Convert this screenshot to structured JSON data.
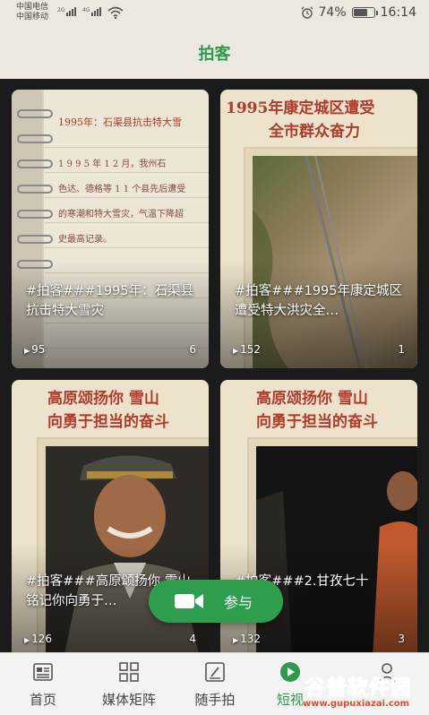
{
  "status_bar": {
    "carrier_1": "中国电信",
    "carrier_2": "中国移动",
    "net_1": "2G",
    "net_2": "4G",
    "battery_level": 0.74,
    "battery_percent": "74%",
    "time": "16:14"
  },
  "header": {
    "title": "拍客"
  },
  "cards": [
    {
      "caption": "#拍客###1995年：石渠县抗击特大雪灾",
      "plays": "95",
      "count": "6",
      "thumb_heading": "1995年：石渠县抗击特大雪",
      "thumb_lines": [
        "1 9 9 5 年 1 2 月，我州石",
        "色达、德格等 1 1 个县先后遭受",
        "的寒潮和特大雪灾，气温下降超",
        "史最高记录。"
      ]
    },
    {
      "caption": "#拍客###1995年康定城区遭受特大洪灾全…",
      "plays": "152",
      "count": "1",
      "thumb_heading_1": "1995年康定城区遭受",
      "thumb_heading_2": "全市群众奋力"
    },
    {
      "caption": "#拍客###高原颂扬你 雪山铭记你向勇于…",
      "plays": "126",
      "count": "4",
      "thumb_heading_1": "高原颂扬你  雪山",
      "thumb_heading_2": "向勇于担当的奋斗"
    },
    {
      "caption": "#拍客###2.甘孜七十",
      "plays": "132",
      "count": "3",
      "thumb_heading_1": "高原颂扬你  雪山",
      "thumb_heading_2": "向勇于担当的奋斗"
    }
  ],
  "fab": {
    "label": "参与",
    "icon": "video-camera-icon"
  },
  "bottom_nav": {
    "items": [
      {
        "label": "首页",
        "icon": "news-icon"
      },
      {
        "label": "媒体矩阵",
        "icon": "grid-icon"
      },
      {
        "label": "随手拍",
        "icon": "edit-icon"
      },
      {
        "label": "短视",
        "icon": "short-video-icon"
      },
      {
        "label": "",
        "icon": "profile-icon"
      }
    ]
  },
  "watermark": {
    "brand": "谷普软件园",
    "url": "www.gupuxiazai.com"
  },
  "colors": {
    "accent": "#2e9a4c",
    "header_bg": "#ece8df",
    "headline_red": "#b03a2c"
  }
}
